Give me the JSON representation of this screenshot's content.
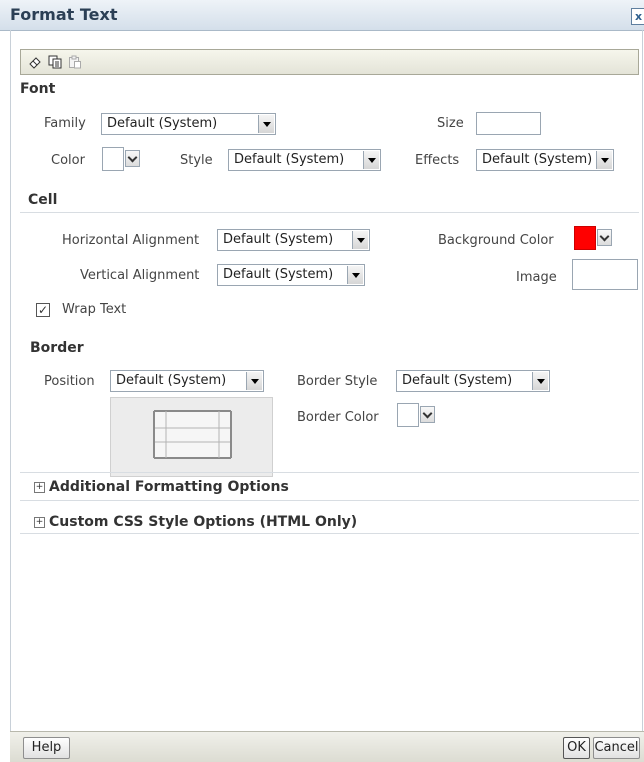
{
  "dialog": {
    "title": "Format Text",
    "close_glyph": "x"
  },
  "toolbar": {
    "icons": [
      "clear-format-icon",
      "copy-format-icon",
      "paste-format-icon"
    ]
  },
  "font": {
    "section": "Font",
    "family_label": "Family",
    "family_value": "Default (System)",
    "size_label": "Size",
    "size_value": "",
    "color_label": "Color",
    "color_value": "#ffffff",
    "style_label": "Style",
    "style_value": "Default (System)",
    "effects_label": "Effects",
    "effects_value": "Default (System)"
  },
  "cell": {
    "section": "Cell",
    "h_align_label": "Horizontal Alignment",
    "h_align_value": "Default (System)",
    "bg_color_label": "Background Color",
    "bg_color_value": "#ff0000",
    "v_align_label": "Vertical Alignment",
    "v_align_value": "Default (System)",
    "image_label": "Image",
    "wrap_label": "Wrap Text",
    "wrap_checked": true
  },
  "border": {
    "section": "Border",
    "position_label": "Position",
    "position_value": "Default (System)",
    "style_label": "Border Style",
    "style_value": "Default (System)",
    "color_label": "Border Color",
    "color_value": "#ffffff"
  },
  "expanders": {
    "additional": "Additional Formatting Options",
    "custom_css": "Custom CSS Style Options (HTML Only)"
  },
  "footer": {
    "help": "Help",
    "ok": "OK",
    "cancel": "Cancel"
  }
}
